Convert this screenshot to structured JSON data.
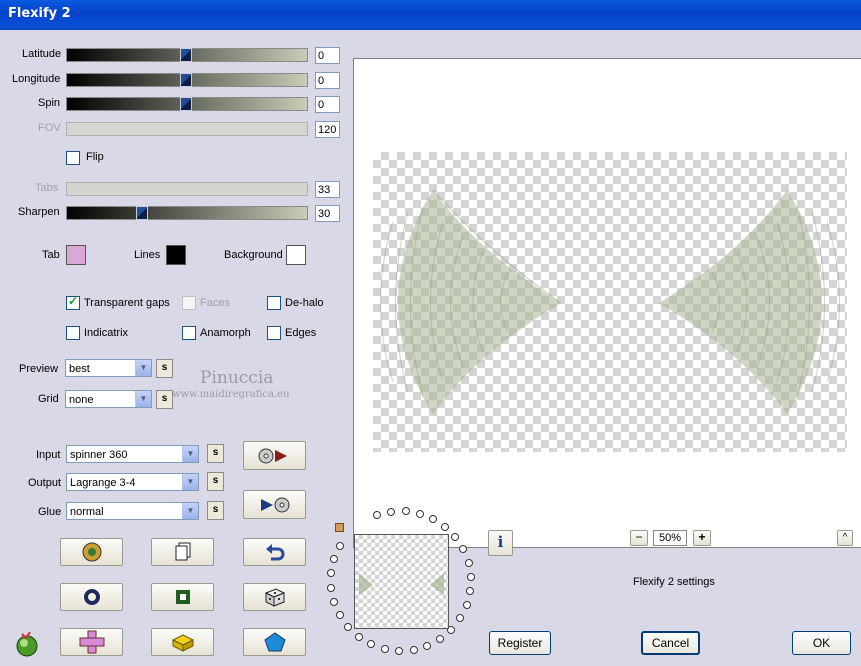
{
  "window": {
    "title": "Flexify 2"
  },
  "sliders": {
    "latitude": {
      "label": "Latitude",
      "value": "0",
      "level": 0.5
    },
    "longitude": {
      "label": "Longitude",
      "value": "0",
      "level": 0.5
    },
    "spin": {
      "label": "Spin",
      "value": "0",
      "level": 0.5
    },
    "fov": {
      "label": "FOV",
      "value": "120"
    },
    "tabs": {
      "label": "Tabs",
      "value": "33"
    },
    "sharpen": {
      "label": "Sharpen",
      "value": "30",
      "level": 0.31
    }
  },
  "flip": {
    "label": "Flip",
    "checked": false
  },
  "colors": {
    "tab": {
      "label": "Tab",
      "color": "#d8a8d8"
    },
    "lines": {
      "label": "Lines",
      "color": "#000000"
    },
    "background": {
      "label": "Background",
      "color": "#ffffff"
    }
  },
  "options": {
    "transparent_gaps": {
      "label": "Transparent gaps",
      "checked": true
    },
    "faces": {
      "label": "Faces",
      "checked": false
    },
    "de_halo": {
      "label": "De-halo",
      "checked": false
    },
    "indicatrix": {
      "label": "Indicatrix",
      "checked": false
    },
    "anamorph": {
      "label": "Anamorph",
      "checked": false
    },
    "edges": {
      "label": "Edges",
      "checked": false
    }
  },
  "preview_select": {
    "label": "Preview",
    "value": "best"
  },
  "grid_select": {
    "label": "Grid",
    "value": "none"
  },
  "input_select": {
    "label": "Input",
    "value": "spinner 360"
  },
  "output_select": {
    "label": "Output",
    "value": "Lagrange 3-4"
  },
  "glue_select": {
    "label": "Glue",
    "value": "normal"
  },
  "s_label": "s",
  "watermark": {
    "name": "Pinuccia",
    "url": "www.maidiregrafica.eu"
  },
  "zoom": {
    "minus": "−",
    "value": "50%",
    "plus": "+",
    "up": "^"
  },
  "info_label": "i",
  "settings_label": "Flexify 2 settings",
  "buttons": {
    "register": "Register",
    "cancel": "Cancel",
    "ok": "OK"
  },
  "accent_color": "#a7b492"
}
